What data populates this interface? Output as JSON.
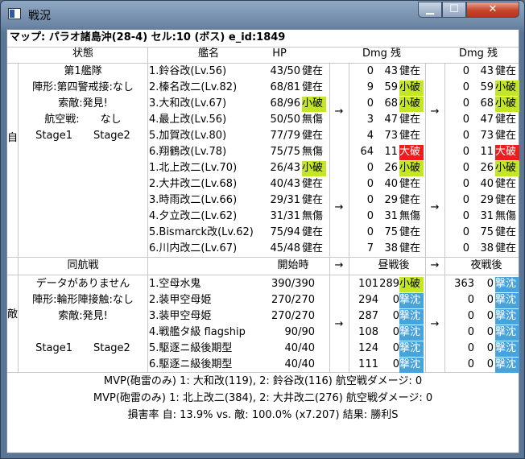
{
  "window": {
    "title": "戦況"
  },
  "header": {
    "map_line": "マップ: パラオ諸島沖(28-4) セル:10 (ボス) e_id:1849"
  },
  "columns": {
    "status": "状態",
    "ship": "艦名",
    "hp": "HP",
    "dmg1": "Dmg 残",
    "dmg2": "Dmg 残"
  },
  "friendly": {
    "side_label": "自",
    "info": [
      "第1艦隊",
      "陣形:第四警戒接:なし",
      "索敵:発見!",
      "航空戦:　　なし",
      "Stage1　　Stage2"
    ],
    "ships": [
      {
        "name": "1.鈴谷改(Lv.56)",
        "hp": "43/50",
        "s0": "健在",
        "d1": "0",
        "r1": "43",
        "s1": "健在",
        "d2": "0",
        "r2": "43",
        "s2": "健在"
      },
      {
        "name": "2.榛名改二(Lv.82)",
        "hp": "68/81",
        "s0": "健在",
        "d1": "9",
        "r1": "59",
        "s1": "小破",
        "d2": "0",
        "r2": "59",
        "s2": "小破"
      },
      {
        "name": "3.大和改(Lv.67)",
        "hp": "68/96",
        "s0": "小破",
        "d1": "0",
        "r1": "68",
        "s1": "小破",
        "d2": "0",
        "r2": "68",
        "s2": "小破"
      },
      {
        "name": "4.最上改(Lv.56)",
        "hp": "50/50",
        "s0": "無傷",
        "d1": "3",
        "r1": "47",
        "s1": "健在",
        "d2": "0",
        "r2": "47",
        "s2": "健在"
      },
      {
        "name": "5.加賀改(Lv.80)",
        "hp": "77/79",
        "s0": "健在",
        "d1": "4",
        "r1": "73",
        "s1": "健在",
        "d2": "0",
        "r2": "73",
        "s2": "健在"
      },
      {
        "name": "6.翔鶴改(Lv.78)",
        "hp": "75/75",
        "s0": "無傷",
        "d1": "64",
        "r1": "11",
        "s1": "大破",
        "d2": "0",
        "r2": "11",
        "s2": "大破"
      },
      {
        "name": "1.北上改二(Lv.70)",
        "hp": "26/43",
        "s0": "小破",
        "d1": "0",
        "r1": "26",
        "s1": "小破",
        "d2": "0",
        "r2": "26",
        "s2": "小破"
      },
      {
        "name": "2.大井改二(Lv.68)",
        "hp": "40/43",
        "s0": "健在",
        "d1": "0",
        "r1": "40",
        "s1": "健在",
        "d2": "0",
        "r2": "40",
        "s2": "健在"
      },
      {
        "name": "3.時雨改二(Lv.66)",
        "hp": "29/31",
        "s0": "健在",
        "d1": "0",
        "r1": "29",
        "s1": "健在",
        "d2": "0",
        "r2": "29",
        "s2": "健在"
      },
      {
        "name": "4.夕立改二(Lv.62)",
        "hp": "31/31",
        "s0": "無傷",
        "d1": "0",
        "r1": "31",
        "s1": "無傷",
        "d2": "0",
        "r2": "31",
        "s2": "無傷"
      },
      {
        "name": "5.Bismarck改(Lv.62)",
        "hp": "75/94",
        "s0": "健在",
        "d1": "0",
        "r1": "75",
        "s1": "健在",
        "d2": "0",
        "r2": "75",
        "s2": "健在"
      },
      {
        "name": "6.川内改二(Lv.67)",
        "hp": "45/48",
        "s0": "健在",
        "d1": "7",
        "r1": "38",
        "s1": "健在",
        "d2": "0",
        "r2": "38",
        "s2": "健在"
      }
    ]
  },
  "mid": {
    "formation": "同航戦",
    "start": "開始時",
    "day": "昼戦後",
    "night": "夜戦後"
  },
  "enemy": {
    "side_label": "敵",
    "info": [
      "データがありません",
      "陣形:輪形陣接触:なし",
      "索敵:発見!",
      "",
      "Stage1　　Stage2"
    ],
    "ships": [
      {
        "name": "1.空母水鬼",
        "hp": "390/390",
        "d1": "101",
        "r1": "289",
        "s1": "小破",
        "d2": "363",
        "r2": "0",
        "s2": "撃沈"
      },
      {
        "name": "2.装甲空母姫",
        "hp": "270/270",
        "d1": "294",
        "r1": "0",
        "s1": "撃沈",
        "d2": "0",
        "r2": "0",
        "s2": "撃沈"
      },
      {
        "name": "3.装甲空母姫",
        "hp": "270/270",
        "d1": "287",
        "r1": "0",
        "s1": "撃沈",
        "d2": "0",
        "r2": "0",
        "s2": "撃沈"
      },
      {
        "name": "4.戦艦タ級 flagship",
        "hp": "90/90",
        "d1": "108",
        "r1": "0",
        "s1": "撃沈",
        "d2": "0",
        "r2": "0",
        "s2": "撃沈"
      },
      {
        "name": "5.駆逐ニ級後期型",
        "hp": "40/40",
        "d1": "124",
        "r1": "0",
        "s1": "撃沈",
        "d2": "0",
        "r2": "0",
        "s2": "撃沈"
      },
      {
        "name": "6.駆逐ニ級後期型",
        "hp": "40/40",
        "d1": "111",
        "r1": "0",
        "s1": "撃沈",
        "d2": "0",
        "r2": "0",
        "s2": "撃沈"
      }
    ]
  },
  "arrow": "→",
  "footer": [
    "MVP(砲雷のみ) 1: 大和改(119), 2: 鈴谷改(116) 航空戦ダメージ: 0",
    "MVP(砲雷のみ) 1: 北上改二(384), 2: 大井改二(276) 航空戦ダメージ: 0",
    "損害率 自: 13.9% vs. 敵: 100.0% (x7.207) 結果: 勝利S"
  ],
  "colors": {
    "minor": "#c3e628",
    "heavy": "#ee1d1d",
    "sunk": "#47a3db"
  }
}
